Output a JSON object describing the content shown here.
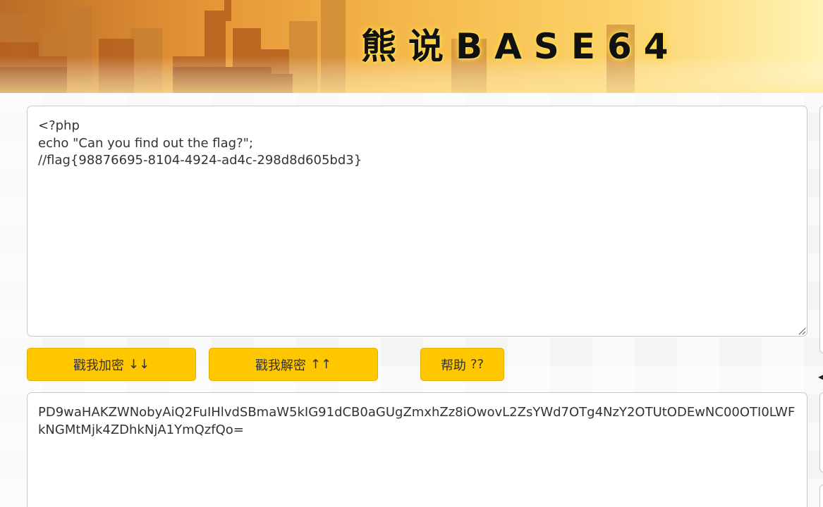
{
  "header": {
    "title": "熊说BASE64"
  },
  "plain_input": {
    "value": "<?php\necho \"Can you find out the flag?\";\n//flag{98876695-8104-4924-ad4c-298d8d605bd3}"
  },
  "buttons": {
    "encode_label": "戳我加密",
    "encode_icon": "↓↓",
    "decode_label": "戳我解密",
    "decode_icon": "↑↑",
    "help_label": "帮助",
    "help_icon": "??"
  },
  "cipher_output": {
    "value": "PD9waHAKZWNobyAiQ2FuIHlvdSBmaW5kIG91dCB0aGUgZmxhZz8iOwovL2ZsYWd7OTg4NzY2OTUtODEwNC00OTI0LWFkNGMtMjk4ZDhkNjA1YmQzfQo="
  },
  "colors": {
    "button_bg": "#ffc700",
    "text": "#333333",
    "border": "#c9c9c9"
  }
}
